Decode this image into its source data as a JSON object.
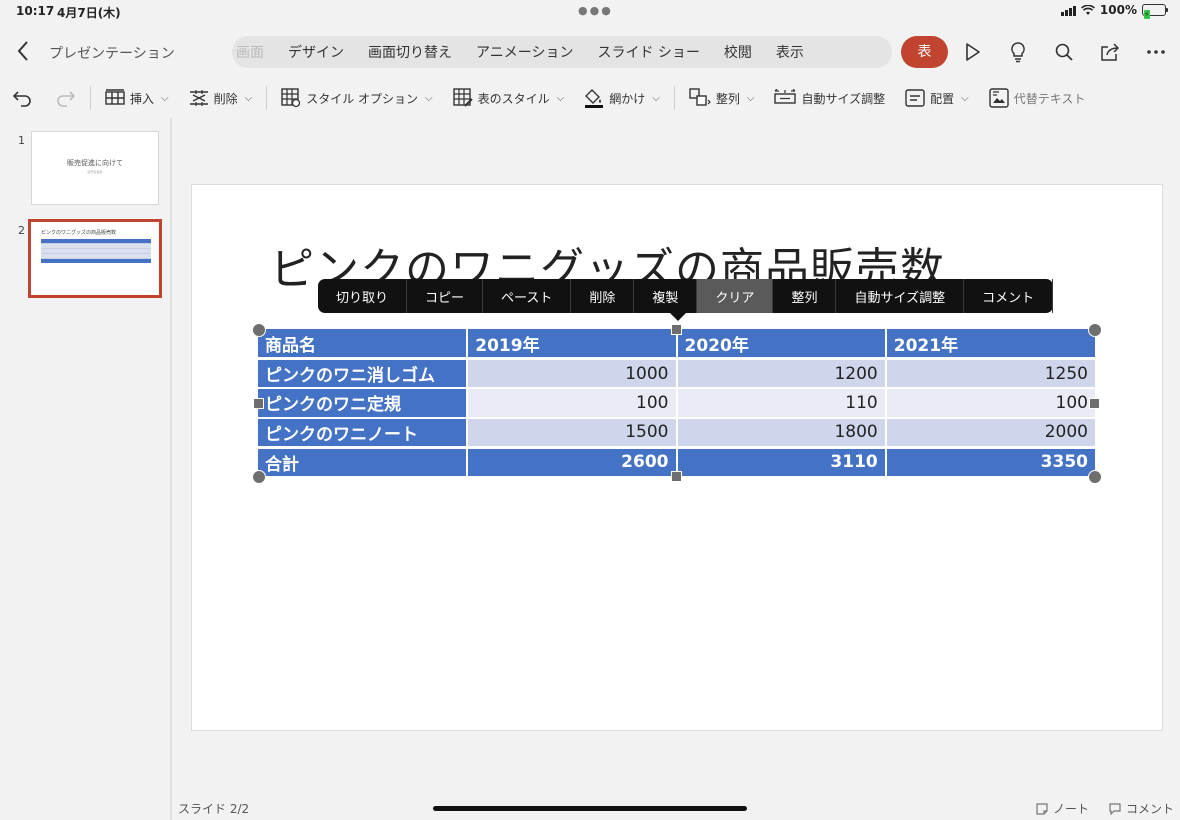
{
  "status": {
    "time": "10:17",
    "date": "4月7日(木)",
    "battery": "100%"
  },
  "header": {
    "doc_name": "プレゼンテーション",
    "tabs": [
      {
        "label": "画面"
      },
      {
        "label": "デザイン"
      },
      {
        "label": "画面切り替え"
      },
      {
        "label": "アニメーション"
      },
      {
        "label": "スライド ショー"
      },
      {
        "label": "校閲"
      },
      {
        "label": "表示"
      }
    ],
    "active_tab": "表"
  },
  "ribbon": {
    "insert": "挿入",
    "delete": "削除",
    "style_options": "スタイル オプション",
    "table_styles": "表のスタイル",
    "shading": "網かけ",
    "arrange": "整列",
    "autofit": "自動サイズ調整",
    "align": "配置",
    "alt_text": "代替テキスト"
  },
  "thumbnails": [
    {
      "num": "1",
      "title": "販売促進に向けて",
      "subtitle": "販売促進部"
    },
    {
      "num": "2",
      "title": "ピンクのワニグッズの商品販売数"
    }
  ],
  "slide": {
    "title": "ピンクのワニグッズの商品販売数",
    "table": {
      "headers": [
        "商品名",
        "2019年",
        "2020年",
        "2021年"
      ],
      "rows": [
        {
          "name": "ピンクのワニ消しゴム",
          "v2019": "1000",
          "v2020": "1200",
          "v2021": "1250"
        },
        {
          "name": "ピンクのワニ定規",
          "v2019": "100",
          "v2020": "110",
          "v2021": "100"
        },
        {
          "name": "ピンクのワニノート",
          "v2019": "1500",
          "v2020": "1800",
          "v2021": "2000"
        }
      ],
      "total": {
        "name": "合計",
        "v2019": "2600",
        "v2020": "3110",
        "v2021": "3350"
      }
    }
  },
  "context_menu": {
    "items": [
      "切り取り",
      "コピー",
      "ペースト",
      "削除",
      "複製",
      "クリア",
      "整列",
      "自動サイズ調整",
      "コメント"
    ],
    "active": "クリア"
  },
  "footer": {
    "slide_count": "スライド 2/2",
    "notes": "ノート",
    "comments": "コメント"
  },
  "colors": {
    "accent": "#c0442f",
    "table_header": "#4472c4",
    "table_dark": "#cfd5ea",
    "table_light": "#e9ebf5"
  }
}
